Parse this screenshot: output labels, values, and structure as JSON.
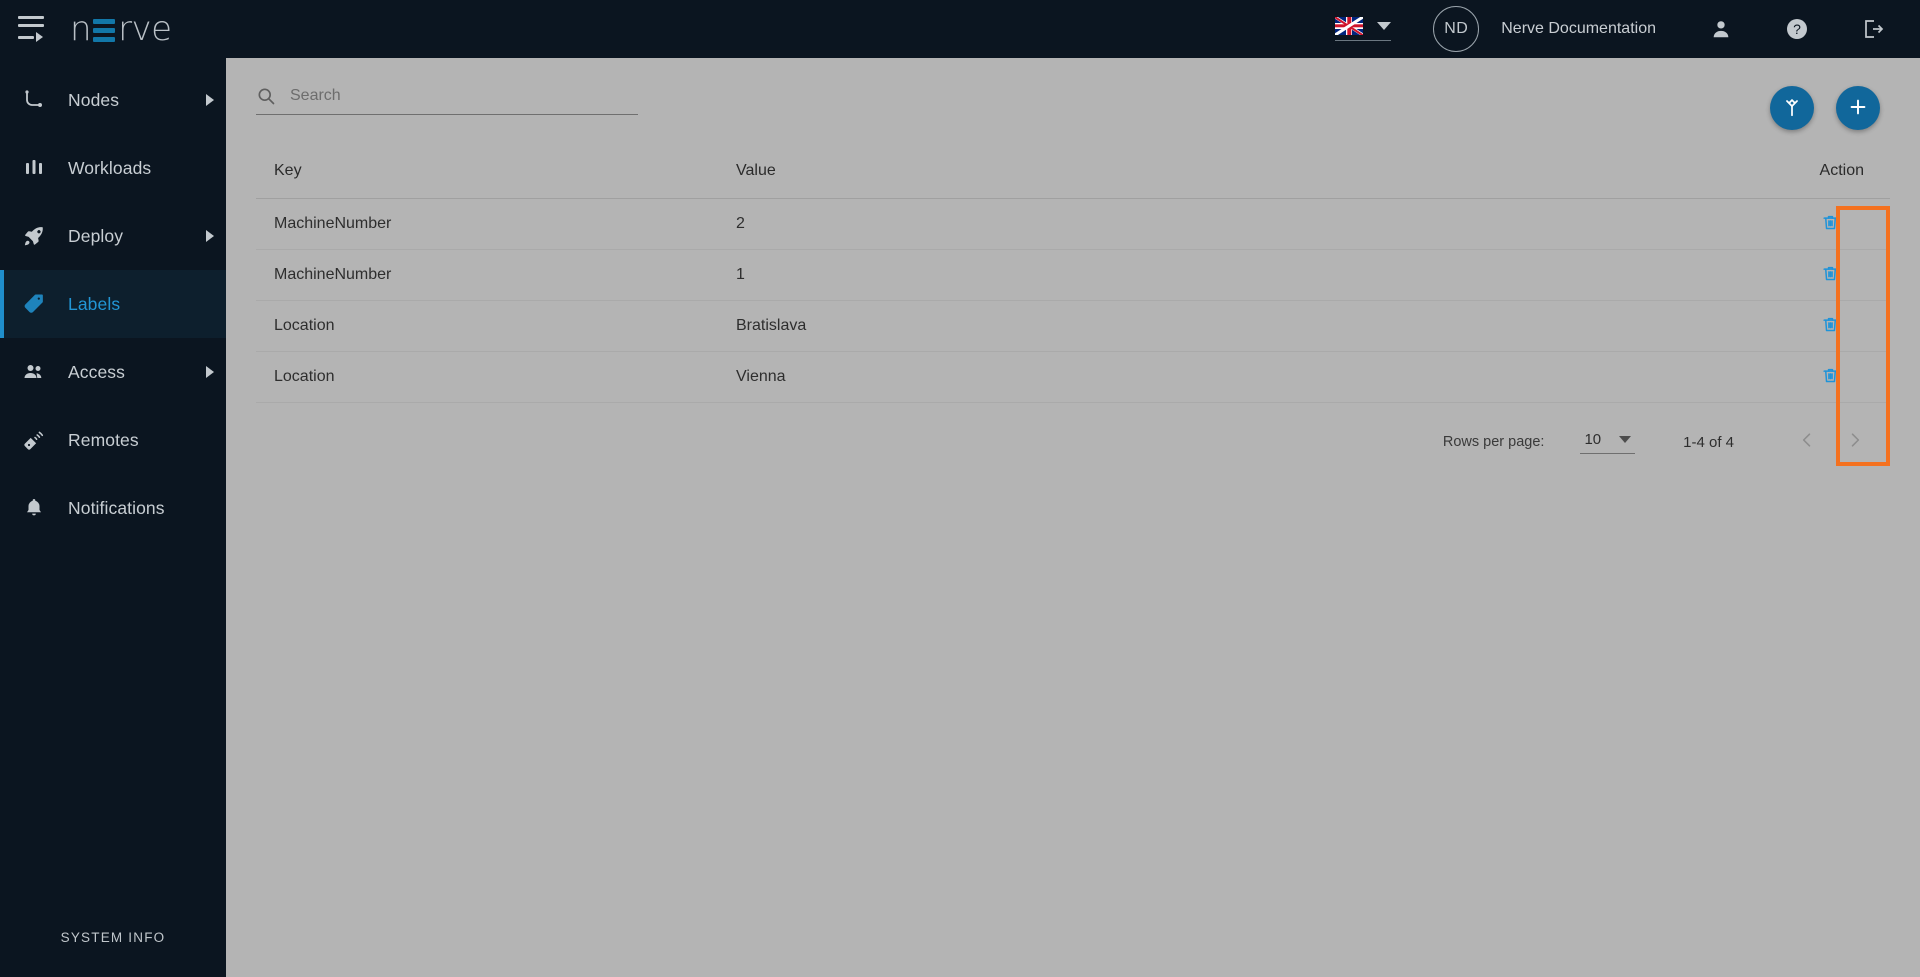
{
  "topbar": {
    "menu_icon": "hamburger-collapse-icon",
    "brand": {
      "part1": "n",
      "part2": "rve"
    },
    "language": {
      "flag": "uk-flag-icon",
      "selected": "en"
    },
    "avatar_initials": "ND",
    "org_name": "Nerve Documentation",
    "user_icon": "user-icon",
    "help_icon": "help-circle-icon",
    "logout_icon": "logout-icon"
  },
  "sidebar": {
    "items": [
      {
        "label": "Nodes",
        "icon": "nodes-icon",
        "has_submenu": true,
        "active": false
      },
      {
        "label": "Workloads",
        "icon": "workloads-icon",
        "has_submenu": false,
        "active": false
      },
      {
        "label": "Deploy",
        "icon": "rocket-icon",
        "has_submenu": true,
        "active": false
      },
      {
        "label": "Labels",
        "icon": "label-tag-icon",
        "has_submenu": false,
        "active": true
      },
      {
        "label": "Access",
        "icon": "people-icon",
        "has_submenu": true,
        "active": false
      },
      {
        "label": "Remotes",
        "icon": "remote-icon",
        "has_submenu": false,
        "active": false
      },
      {
        "label": "Notifications",
        "icon": "bell-icon",
        "has_submenu": false,
        "active": false
      }
    ],
    "footer_label": "SYSTEM INFO"
  },
  "toolbar": {
    "search": {
      "placeholder": "Search",
      "value": "",
      "icon": "search-icon"
    },
    "merge_button": {
      "icon": "merge-icon"
    },
    "add_button": {
      "icon": "plus-icon"
    }
  },
  "table": {
    "columns": [
      "Key",
      "Value",
      "Action"
    ],
    "rows": [
      {
        "key": "MachineNumber",
        "value": "2"
      },
      {
        "key": "MachineNumber",
        "value": "1"
      },
      {
        "key": "Location",
        "value": "Bratislava"
      },
      {
        "key": "Location",
        "value": "Vienna"
      }
    ],
    "row_action_icon": "trash-icon"
  },
  "pagination": {
    "rows_per_page_label": "Rows per page:",
    "rows_per_page_value": "10",
    "range_text": "1-4 of 4",
    "prev_icon": "chevron-left-icon",
    "next_icon": "chevron-right-icon"
  },
  "colors": {
    "sidebar_bg": "#0b1520",
    "topbar_bg": "#0b1520",
    "page_bg": "#b4b4b4",
    "accent_blue": "#11679b",
    "active_blue": "#2295d4",
    "trash_blue": "#1f93d8",
    "highlight_orange": "#f4711f"
  }
}
